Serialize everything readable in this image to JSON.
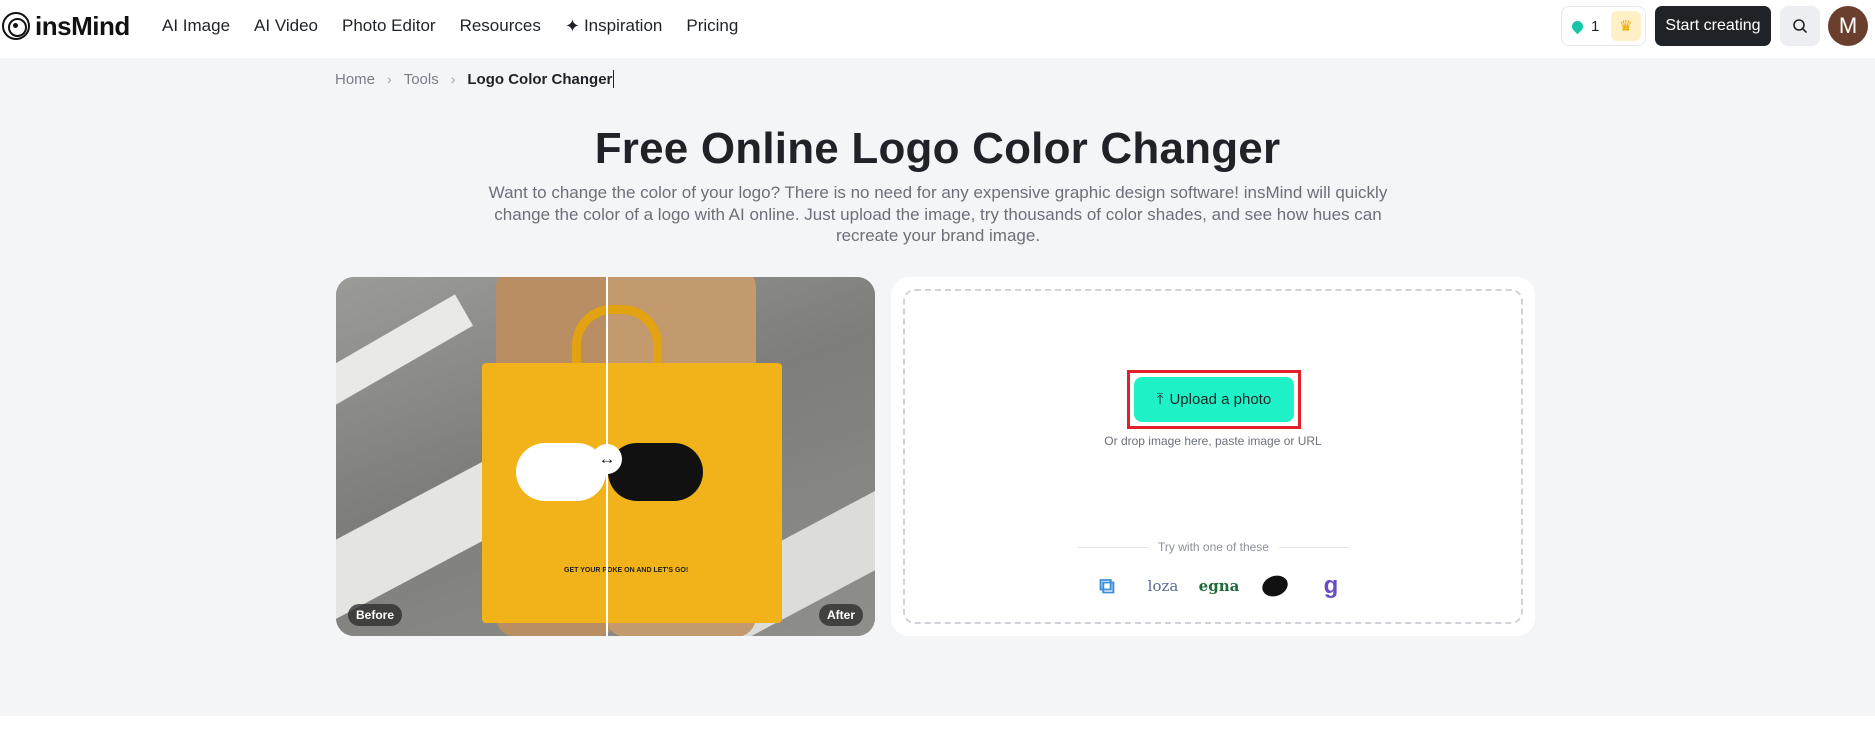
{
  "header": {
    "brand": "insMind",
    "nav": [
      "AI Image",
      "AI Video",
      "Photo Editor",
      "Resources",
      "Inspiration",
      "Pricing"
    ],
    "credits": "1",
    "start_label": "Start creating",
    "avatar_initial": "M"
  },
  "breadcrumb": {
    "home": "Home",
    "tools": "Tools",
    "current": "Logo Color Changer"
  },
  "hero": {
    "title": "Free Online Logo Color Changer",
    "description": "Want to change the color of your logo? There is no need for any expensive graphic design software! insMind will quickly change the color of a logo with AI online. Just upload the image, try thousands of color shades, and see how hues can recreate your brand image."
  },
  "compare": {
    "before_label": "Before",
    "after_label": "After",
    "bag_text": "GET YOUR POKE ON AND LET'S GO!"
  },
  "upload": {
    "button_label": "Upload a photo",
    "hint": "Or drop image here, paste image or URL",
    "try_label": "Try with one of these",
    "samples": [
      "loza",
      "egna",
      "g"
    ]
  },
  "colors": {
    "accent": "#1ef2c6",
    "dark_button": "#1f2328",
    "highlight": "#e0202a",
    "page_bg": "#f4f5f7"
  }
}
